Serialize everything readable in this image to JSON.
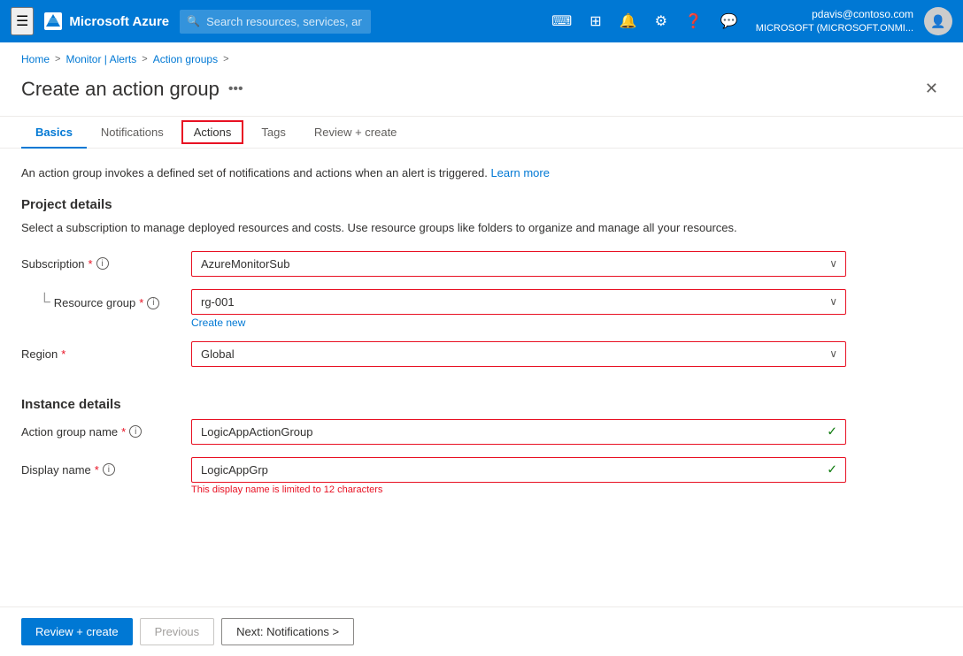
{
  "topbar": {
    "hamburger": "☰",
    "logo_text": "Microsoft Azure",
    "search_placeholder": "Search resources, services, and docs (G+/)",
    "user_name": "pdavis@contoso.com",
    "user_tenant": "MICROSOFT (MICROSOFT.ONMI...",
    "icons": [
      "📋",
      "🔲",
      "🔔",
      "⚙",
      "❓",
      "💬"
    ]
  },
  "breadcrumb": {
    "items": [
      "Home",
      "Monitor | Alerts",
      "Action groups"
    ],
    "separators": [
      ">",
      ">",
      ">"
    ]
  },
  "page": {
    "title": "Create an action group",
    "more_icon": "•••",
    "close_icon": "✕"
  },
  "tabs": [
    {
      "id": "basics",
      "label": "Basics",
      "active": true,
      "outlined": false
    },
    {
      "id": "notifications",
      "label": "Notifications",
      "active": false,
      "outlined": false
    },
    {
      "id": "actions",
      "label": "Actions",
      "active": false,
      "outlined": true
    },
    {
      "id": "tags",
      "label": "Tags",
      "active": false,
      "outlined": false
    },
    {
      "id": "review-create",
      "label": "Review + create",
      "active": false,
      "outlined": false
    }
  ],
  "info_text": "An action group invokes a defined set of notifications and actions when an alert is triggered.",
  "info_link": "Learn more",
  "project_details": {
    "title": "Project details",
    "description": "Select a subscription to manage deployed resources and costs. Use resource groups like folders to organize and manage all your resources."
  },
  "fields": {
    "subscription": {
      "label": "Subscription",
      "required": true,
      "value": "AzureMonitorSub"
    },
    "resource_group": {
      "label": "Resource group",
      "required": true,
      "value": "rg-001",
      "create_new": "Create new"
    },
    "region": {
      "label": "Region",
      "required": true,
      "value": "Global"
    }
  },
  "instance_details": {
    "title": "Instance details"
  },
  "instance_fields": {
    "action_group_name": {
      "label": "Action group name",
      "required": true,
      "value": "LogicAppActionGroup",
      "has_check": true
    },
    "display_name": {
      "label": "Display name",
      "required": true,
      "value": "LogicAppGrp",
      "has_check": true,
      "validation": "This display name is limited to 12 characters"
    }
  },
  "footer": {
    "review_create": "Review + create",
    "previous": "Previous",
    "next": "Next: Notifications >"
  }
}
